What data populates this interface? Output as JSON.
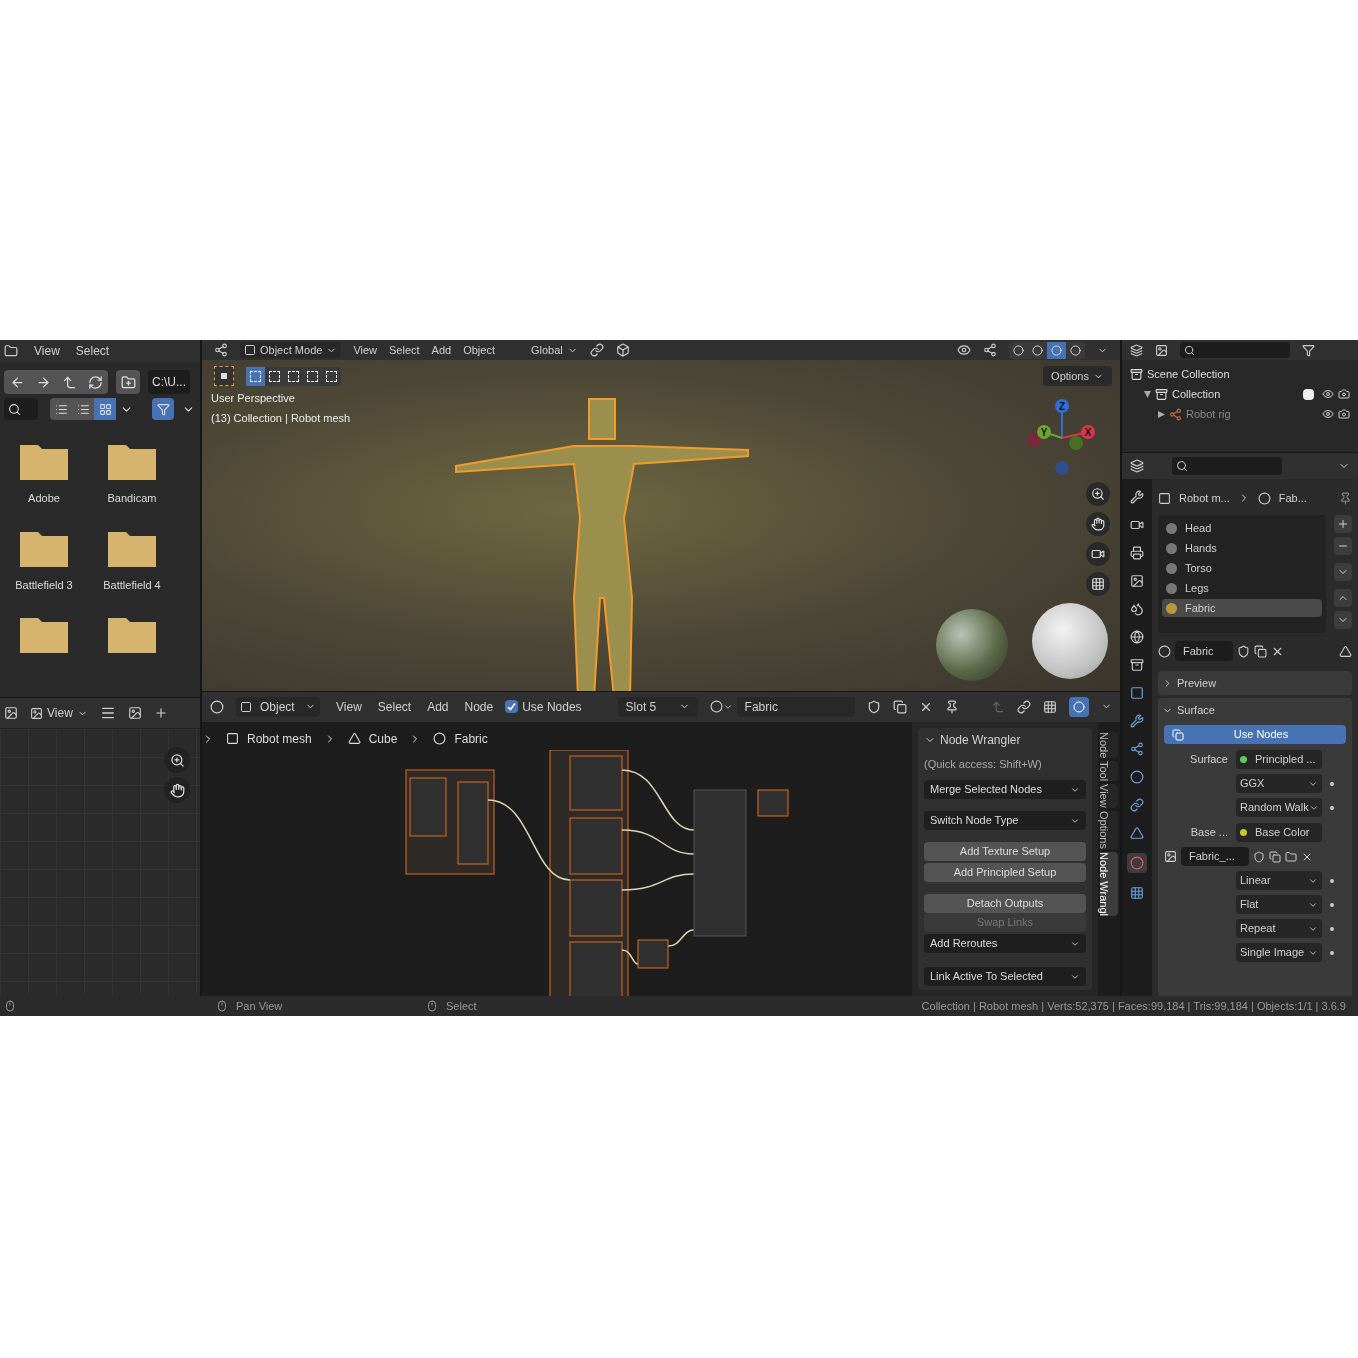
{
  "file_browser": {
    "menus": [
      "View",
      "Select"
    ],
    "path": "C:\\U...",
    "display_modes": [
      {
        "selected": false
      },
      {
        "selected": false
      },
      {
        "selected": true
      }
    ],
    "filter_on": true,
    "folders": [
      {
        "name": "Adobe"
      },
      {
        "name": "Bandicam"
      },
      {
        "name": "Battlefield 3"
      },
      {
        "name": "Battlefield 4"
      }
    ]
  },
  "viewport": {
    "mode": "Object Mode",
    "menus": [
      "View",
      "Select",
      "Add",
      "Object"
    ],
    "orientation": "Global",
    "options": "Options",
    "select_modes": [
      {
        "selected": true
      },
      {
        "selected": false
      },
      {
        "selected": false
      },
      {
        "selected": false
      },
      {
        "selected": false
      }
    ],
    "overlay_lines": [
      "User Perspective",
      "(13) Collection | Robot mesh"
    ],
    "gizmo_axes": [
      {
        "label": "Z",
        "color": "#2e6fd8"
      },
      {
        "label": "Y",
        "color": "#6ba52d"
      },
      {
        "label": "X",
        "color": "#d8344a"
      }
    ],
    "shading": [
      {
        "selected": false
      },
      {
        "selected": false
      },
      {
        "selected": true
      },
      {
        "selected": false
      }
    ]
  },
  "outliner": {
    "items": [
      {
        "name": "Scene Collection",
        "children": [
          {
            "name": "Collection",
            "checked": true,
            "children": [
              {
                "name": "Robot rig"
              }
            ]
          }
        ]
      }
    ]
  },
  "properties": {
    "breadcrumb": [
      "Robot m...",
      "Fab..."
    ],
    "material_slots": [
      {
        "name": "Head",
        "selected": false
      },
      {
        "name": "Hands",
        "selected": false
      },
      {
        "name": "Torso",
        "selected": false
      },
      {
        "name": "Legs",
        "selected": false
      },
      {
        "name": "Fabric",
        "selected": true
      }
    ],
    "material": "Fabric",
    "panels": [
      {
        "title": "Preview",
        "expanded": false
      },
      {
        "title": "Surface",
        "expanded": true
      }
    ],
    "use_nodes": "Use Nodes",
    "rows": [
      {
        "kind": "socket",
        "label": "Surface",
        "value": "Principled ...",
        "color": "#5ccb5c"
      },
      {
        "kind": "dropdown",
        "value": "GGX"
      },
      {
        "kind": "dropdown",
        "value": "Random Walk"
      },
      {
        "kind": "socket",
        "label": "Base ...",
        "value": "Base Color",
        "color": "#c8c829"
      },
      {
        "kind": "image",
        "value": "Fabric_..."
      },
      {
        "kind": "dropdown",
        "value": "Linear"
      },
      {
        "kind": "dropdown",
        "value": "Flat"
      },
      {
        "kind": "dropdown",
        "value": "Repeat"
      },
      {
        "kind": "dropdown",
        "value": "Single Image"
      }
    ]
  },
  "image_editor": {
    "view": "View"
  },
  "node_editor": {
    "object": "Object",
    "menus": [
      "View",
      "Select",
      "Add",
      "Node"
    ],
    "use_nodes": {
      "label": "Use Nodes",
      "checked": true
    },
    "slot": "Slot 5",
    "material": "Fabric",
    "breadcrumb": [
      "Robot mesh",
      "Cube",
      "Fabric"
    ],
    "sidebar": {
      "title": "Node Wrangler",
      "hint": "(Quick access: Shift+W)",
      "controls": [
        {
          "kind": "dropdown",
          "label": "Merge Selected Nodes",
          "disabled": false
        },
        {
          "kind": "dropdown",
          "label": "Switch Node Type",
          "disabled": false
        },
        {
          "kind": "button",
          "label": "Add Texture Setup",
          "disabled": false
        },
        {
          "kind": "button",
          "label": "Add Principled Setup",
          "disabled": false
        },
        {
          "kind": "button",
          "label": "Detach Outputs",
          "disabled": false
        },
        {
          "kind": "button",
          "label": "Swap Links",
          "disabled": true
        },
        {
          "kind": "dropdown",
          "label": "Add Reroutes",
          "disabled": false
        },
        {
          "kind": "dropdown",
          "label": "Link Active To Selected",
          "disabled": false
        }
      ]
    },
    "tabs": [
      {
        "label": "Node",
        "selected": false
      },
      {
        "label": "Tool",
        "selected": false
      },
      {
        "label": "View",
        "selected": false
      },
      {
        "label": "Options",
        "selected": false
      },
      {
        "label": "Node Wrangl",
        "selected": true
      }
    ]
  },
  "status_bar": {
    "hints": [
      "Pan View",
      "Select"
    ],
    "stats": "Collection | Robot mesh | Verts:52,375 | Faces:99,184 | Tris:99,184 | Objects:1/1 | 3.6.9"
  }
}
